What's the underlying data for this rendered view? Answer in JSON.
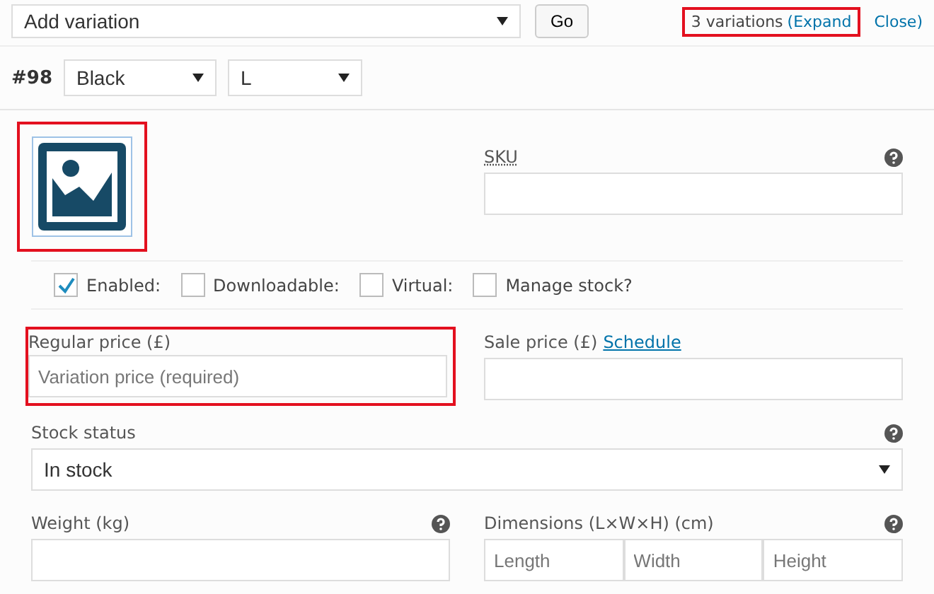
{
  "toolbar": {
    "add_select": "Add variation",
    "go_button": "Go",
    "summary": {
      "count": "3 variations",
      "expand": "(Expand",
      "close": "Close)",
      "highlighted": true
    }
  },
  "variation": {
    "number": "#98",
    "attributes": [
      {
        "value": "Black"
      },
      {
        "value": "L"
      }
    ]
  },
  "image": {
    "highlighted": true
  },
  "sku": {
    "label": "SKU"
  },
  "options": [
    {
      "label": "Enabled:",
      "checked": true
    },
    {
      "label": "Downloadable:",
      "checked": false
    },
    {
      "label": "Virtual:",
      "checked": false
    },
    {
      "label": "Manage stock?",
      "checked": false
    }
  ],
  "regular_price": {
    "label": "Regular price (£)",
    "placeholder": "Variation price (required)",
    "highlighted": true
  },
  "sale_price": {
    "label": "Sale price (£)",
    "link": "Schedule"
  },
  "stock_status": {
    "label": "Stock status",
    "value": "In stock"
  },
  "weight": {
    "label": "Weight (kg)"
  },
  "dimensions": {
    "label": "Dimensions (L×W×H) (cm)",
    "placeholders": [
      "Length",
      "Width",
      "Height"
    ]
  }
}
